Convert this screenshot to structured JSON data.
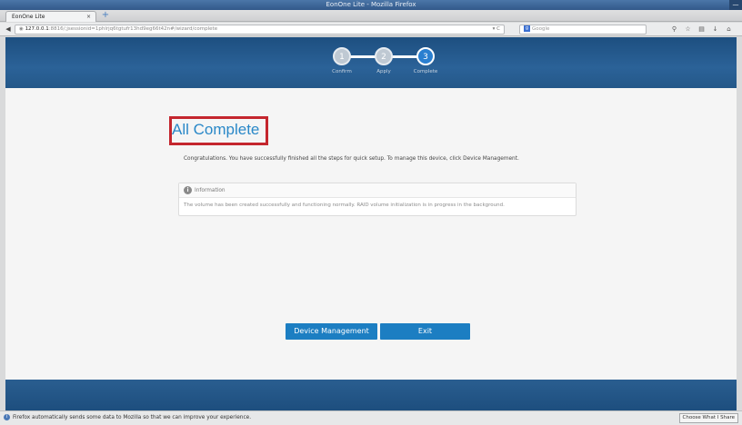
{
  "window": {
    "title": "EonOne Lite - Mozilla Firefox",
    "control": "—"
  },
  "browser": {
    "tab_title": "EonOne Lite",
    "tab_close": "×",
    "new_tab": "+",
    "url_host": "127.0.0.1",
    "url_rest": ":8816/;jsessionid=1phlrjq6tgtufr13hd9eg66t42n#/wizard/complete",
    "search_placeholder": "Google",
    "url_actions": "▾ C"
  },
  "stepper": {
    "steps": [
      {
        "number": "1",
        "label": "Confirm"
      },
      {
        "number": "2",
        "label": "Apply"
      },
      {
        "number": "3",
        "label": "Complete"
      }
    ]
  },
  "main": {
    "heading": "All Complete",
    "congrats": "Congratulations. You have successfully finished all the steps for quick setup. To manage this device, click Device Management.",
    "info_title": "Information",
    "info_text": "The volume has been created successfully and functioning normally. RAID volume initialization is in progress in the background."
  },
  "buttons": {
    "device_management": "Device Management",
    "exit": "Exit"
  },
  "notification": {
    "text": "Firefox automatically sends some data to Mozilla so that we can improve your experience.",
    "button": "Choose What I Share"
  },
  "colors": {
    "accent": "#1c7ec2",
    "heading": "#2a88c8",
    "highlight_box": "#c4262e",
    "header_bg": "#245889"
  }
}
